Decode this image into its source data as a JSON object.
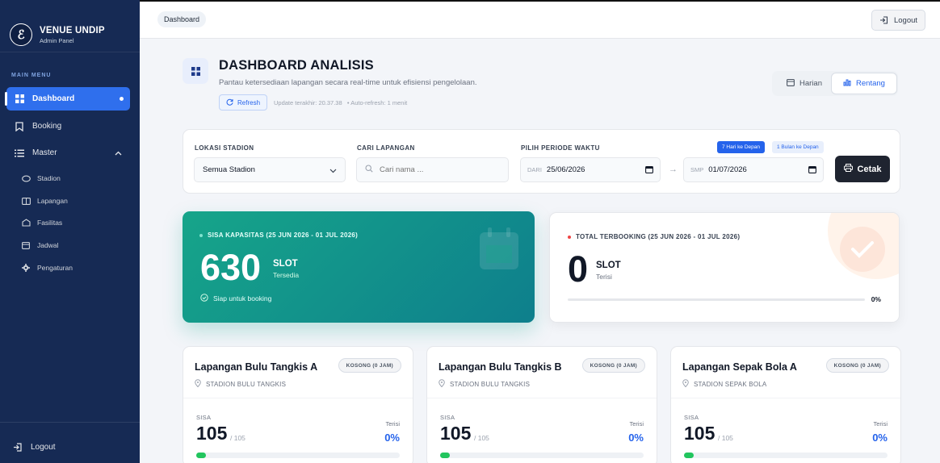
{
  "brand": {
    "title": "VENUE UNDIP",
    "subtitle": "Admin Panel",
    "logo_glyph": "ℰ"
  },
  "sidebar": {
    "menu_title": "MAIN MENU",
    "items": [
      {
        "label": "Dashboard",
        "icon": "grid-icon",
        "active": true
      },
      {
        "label": "Booking",
        "icon": "bookmark-icon"
      },
      {
        "label": "Master",
        "icon": "list-icon"
      }
    ],
    "sub_items": [
      {
        "label": "Stadion",
        "icon": "stadium-icon"
      },
      {
        "label": "Lapangan",
        "icon": "field-icon"
      },
      {
        "label": "Fasilitas",
        "icon": "facility-icon"
      },
      {
        "label": "Jadwal",
        "icon": "calendar-icon"
      },
      {
        "label": "Pengaturan",
        "icon": "gear-icon"
      }
    ],
    "logout_label": "Logout"
  },
  "header": {
    "breadcrumb": "Dashboard",
    "logout_label": "Logout"
  },
  "page": {
    "title": "DASHBOARD ANALISIS",
    "description": "Pantau ketersediaan lapangan secara real-time untuk efisiensi pengelolaan.",
    "refresh_label": "Refresh",
    "update_text": "Update terakhir: 20.37.38",
    "auto_refresh": "• Auto-refresh: 1 menit",
    "toggle": {
      "harian": "Harian",
      "rentang": "Rentang",
      "active": "rentang"
    }
  },
  "filters": {
    "lokasi_label": "LOKASI STADION",
    "lokasi_value": "Semua Stadion",
    "cari_label": "CARI LAPANGAN",
    "cari_placeholder": "Cari nama ...",
    "periode_label": "PILIH PERIODE WAKTU",
    "chip_7": "7 Hari ke Depan",
    "chip_30": "1 Bulan ke Depan",
    "dari_prefix": "DARI",
    "dari_value": "25/06/2026",
    "smp_prefix": "SMP",
    "smp_value": "01/07/2026",
    "cetak_label": "Cetak"
  },
  "stats": {
    "sisa": {
      "label": "SISA KAPASITAS (25 JUN 2026 - 01 JUL 2026)",
      "value": "630",
      "unit": "SLOT",
      "sub": "Tersedia",
      "note": "Siap untuk booking"
    },
    "booked": {
      "label": "TOTAL TERBOOKING (25 JUN 2026 - 01 JUL 2026)",
      "value": "0",
      "unit": "SLOT",
      "sub": "Terisi",
      "percent": "0%"
    }
  },
  "courts": [
    {
      "name": "Lapangan Bulu Tangkis A",
      "location": "STADION BULU TANGKIS",
      "badge": "KOSONG (0 JAM)",
      "sisa_label": "SISA",
      "sisa": "105",
      "total": "/ 105",
      "terisi_label": "Terisi",
      "terisi": "0%"
    },
    {
      "name": "Lapangan Bulu Tangkis B",
      "location": "STADION BULU TANGKIS",
      "badge": "KOSONG (0 JAM)",
      "sisa_label": "SISA",
      "sisa": "105",
      "total": "/ 105",
      "terisi_label": "Terisi",
      "terisi": "0%"
    },
    {
      "name": "Lapangan Sepak Bola A",
      "location": "STADION SEPAK BOLA",
      "badge": "KOSONG (0 JAM)",
      "sisa_label": "SISA",
      "sisa": "105",
      "total": "/ 105",
      "terisi_label": "Terisi",
      "terisi": "0%"
    }
  ],
  "colors": {
    "sidebar": "#162a54",
    "accent": "#2f6fed",
    "green": "#16a58a",
    "dark_button": "#1f2430"
  }
}
